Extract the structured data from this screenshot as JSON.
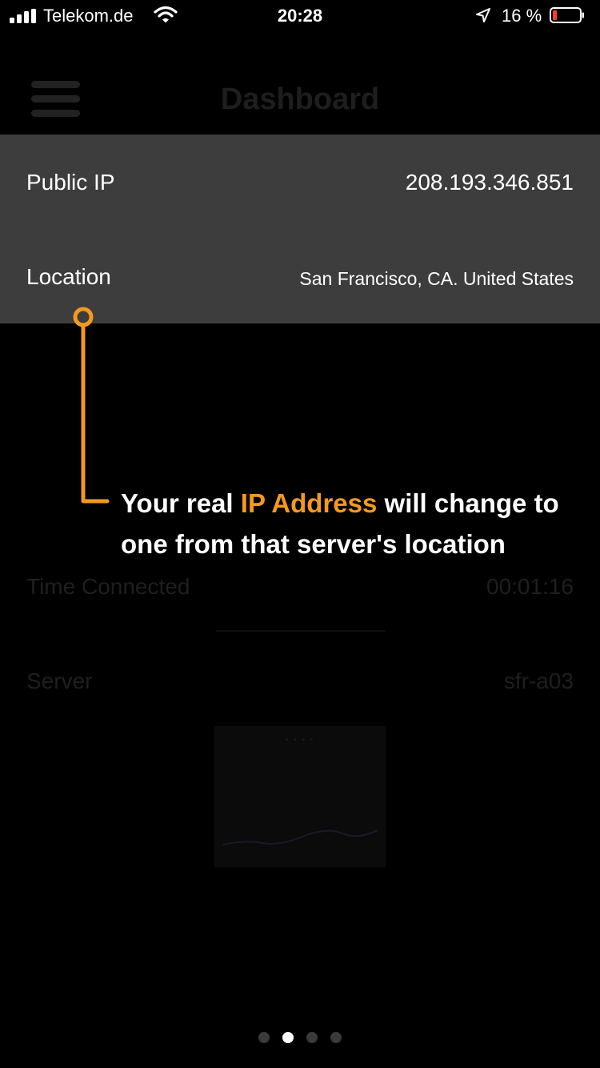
{
  "status_bar": {
    "carrier": "Telekom.de",
    "time": "20:28",
    "battery_percent": "16 %",
    "battery_level": 0.16,
    "battery_color": "#ff3b30",
    "icons": [
      "signal-icon",
      "wifi-icon",
      "location-arrow-icon",
      "battery-icon"
    ]
  },
  "header": {
    "title": "Dashboard",
    "menu_icon": "hamburger-menu-icon"
  },
  "info_panel": {
    "public_ip_label": "Public IP",
    "public_ip_value": "208.193.346.851",
    "location_label": "Location",
    "location_value": "San Francisco, CA. United States"
  },
  "dimmed": {
    "time_connected_label": "Time Connected",
    "time_connected_value": "00:01:16",
    "server_label": "Server",
    "server_value": "sfr-a03",
    "chart_label": "• • • •"
  },
  "callout": {
    "text_before": "Your real ",
    "highlight": "IP Address",
    "text_after": " will change to one from that server's location",
    "accent_color": "#f39a1e"
  },
  "pagination": {
    "count": 4,
    "active_index": 1
  }
}
